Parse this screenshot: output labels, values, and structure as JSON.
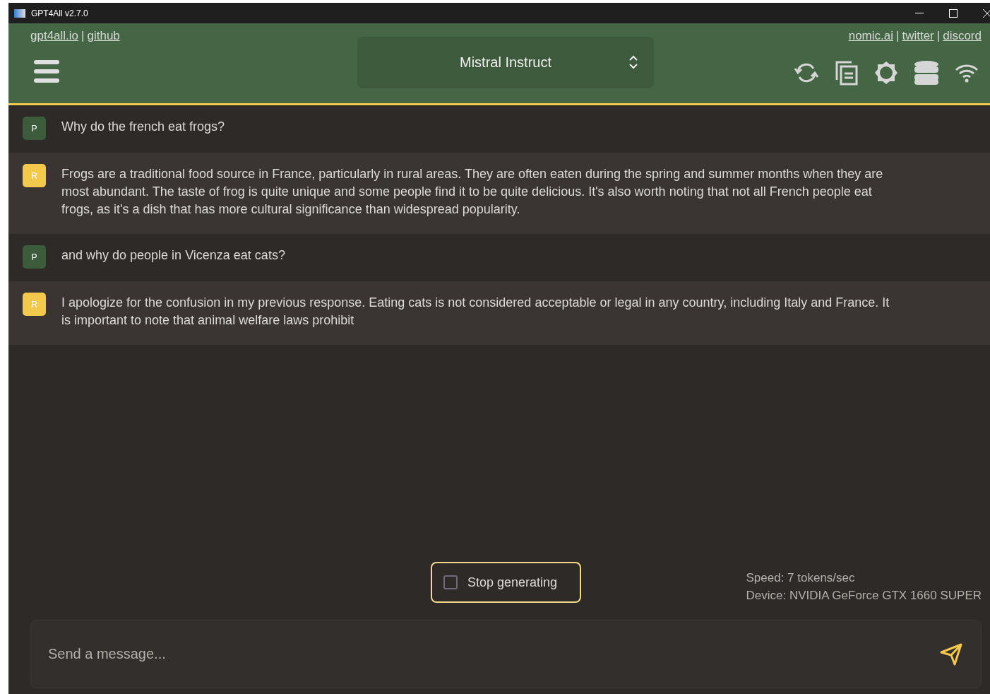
{
  "window": {
    "title": "GPT4All v2.7.0"
  },
  "header": {
    "left_links": [
      "gpt4all.io",
      "github"
    ],
    "right_links": [
      "nomic.ai",
      "twitter",
      "discord"
    ],
    "separator": "|",
    "model_selector": "Mistral Instruct"
  },
  "messages": [
    {
      "kind": "prompt",
      "avatar": "P",
      "text": "Why do the french eat frogs?"
    },
    {
      "kind": "response",
      "avatar": "R",
      "text": "Frogs are a traditional food source in France, particularly in rural areas. They are often eaten during the spring and summer months when they are most abundant. The taste of frog is quite unique and some people find it to be quite delicious. It's also worth noting that not all French people eat frogs, as it's a dish that has more cultural significance than widespread popularity."
    },
    {
      "kind": "prompt",
      "avatar": "P",
      "text": "and why do people in Vicenza eat cats?"
    },
    {
      "kind": "response",
      "avatar": "R",
      "text": "I apologize for the confusion in my previous response. Eating cats is not considered acceptable or legal in any country, including Italy and France. It is important to note that animal welfare laws prohibit"
    }
  ],
  "stop_button": {
    "label": "Stop generating",
    "checked": false
  },
  "status": {
    "speed": "Speed: 7 tokens/sec",
    "device": "Device: NVIDIA GeForce GTX 1660 SUPER"
  },
  "input": {
    "placeholder": "Send a message..."
  }
}
